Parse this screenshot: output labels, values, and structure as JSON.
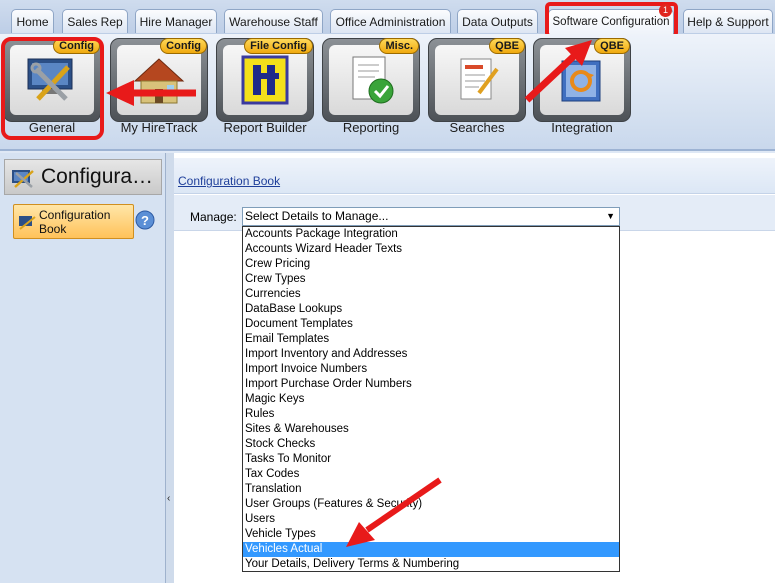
{
  "tabs": [
    {
      "label": "Home"
    },
    {
      "label": "Sales Rep"
    },
    {
      "label": "Hire Manager"
    },
    {
      "label": "Warehouse Staff"
    },
    {
      "label": "Office Administration"
    },
    {
      "label": "Data Outputs"
    },
    {
      "label": "Software Configuration"
    },
    {
      "label": "Help & Support"
    }
  ],
  "notification_badge": "1",
  "ribbon": [
    {
      "label": "General",
      "tag": "Config"
    },
    {
      "label": "My HireTrack",
      "tag": "Config"
    },
    {
      "label": "Report Builder",
      "tag": "File Config"
    },
    {
      "label": "Reporting",
      "tag": "Misc."
    },
    {
      "label": "Searches",
      "tag": "QBE"
    },
    {
      "label": "Integration",
      "tag": "QBE"
    }
  ],
  "left_panel": {
    "title": "Configura…",
    "item_label": "Configuration Book"
  },
  "breadcrumb": "Configuration Book",
  "manage": {
    "label": "Manage:",
    "selected": "Select Details to Manage..."
  },
  "dropdown_options": [
    "Accounts Package Integration",
    "Accounts Wizard Header Texts",
    "Crew Pricing",
    "Crew Types",
    "Currencies",
    "DataBase Lookups",
    "Document Templates",
    "Email Templates",
    "Import Inventory and Addresses",
    "Import Invoice Numbers",
    "Import Purchase Order Numbers",
    "Magic Keys",
    "Rules",
    "Sites & Warehouses",
    "Stock Checks",
    "Tasks To Monitor",
    "Tax Codes",
    "Translation",
    "User Groups (Features & Security)",
    "Users",
    "Vehicle Types",
    "Vehicles Actual",
    "Your Details, Delivery Terms & Numbering"
  ],
  "highlighted_option": "Vehicles Actual",
  "colors": {
    "highlight_red": "#e81a1a",
    "selection_blue": "#3399ff"
  }
}
